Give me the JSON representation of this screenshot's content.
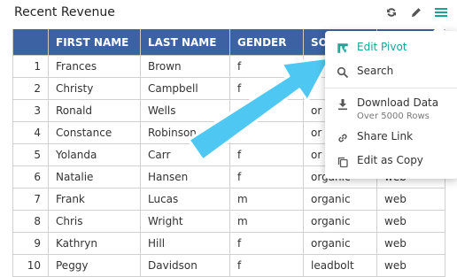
{
  "header": {
    "title": "Recent Revenue"
  },
  "table": {
    "columns": [
      "",
      "FIRST NAME",
      "LAST NAME",
      "GENDER",
      "SO"
    ],
    "rows": [
      {
        "n": "1",
        "first": "Frances",
        "last": "Brown",
        "gender": "f",
        "source": "",
        "channel": ""
      },
      {
        "n": "2",
        "first": "Christy",
        "last": "Campbell",
        "gender": "f",
        "source": "",
        "channel": ""
      },
      {
        "n": "3",
        "first": "Ronald",
        "last": "Wells",
        "gender": "",
        "source": "or",
        "channel": ""
      },
      {
        "n": "4",
        "first": "Constance",
        "last": "Robinson",
        "gender": "",
        "source": "or",
        "channel": ""
      },
      {
        "n": "5",
        "first": "Yolanda",
        "last": "Carr",
        "gender": "f",
        "source": "or",
        "channel": ""
      },
      {
        "n": "6",
        "first": "Natalie",
        "last": "Hansen",
        "gender": "f",
        "source": "organic",
        "channel": "web"
      },
      {
        "n": "7",
        "first": "Frank",
        "last": "Lucas",
        "gender": "m",
        "source": "organic",
        "channel": "web"
      },
      {
        "n": "8",
        "first": "Chris",
        "last": "Wright",
        "gender": "m",
        "source": "organic",
        "channel": "web"
      },
      {
        "n": "9",
        "first": "Kathryn",
        "last": "Hill",
        "gender": "f",
        "source": "organic",
        "channel": "web"
      },
      {
        "n": "10",
        "first": "Peggy",
        "last": "Davidson",
        "gender": "f",
        "source": "leadbolt",
        "channel": "web"
      }
    ]
  },
  "menu": {
    "items": [
      {
        "label": "Edit Pivot",
        "icon": "pivot-icon"
      },
      {
        "label": "Search",
        "icon": "search-icon"
      },
      {
        "label": "Download Data",
        "sub": "Over 5000 Rows",
        "icon": "download-icon"
      },
      {
        "label": "Share Link",
        "icon": "link-icon"
      },
      {
        "label": "Edit as Copy",
        "icon": "copy-icon"
      }
    ]
  },
  "colors": {
    "header_bg": "#3c62a3",
    "accent": "#1aa495",
    "arrow": "#4ec8f2"
  }
}
